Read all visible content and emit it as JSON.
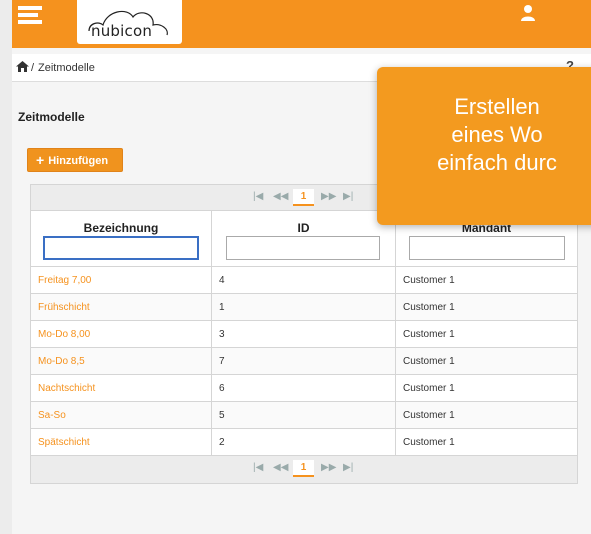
{
  "header": {
    "logo_text": "nubicon",
    "brand_color": "#f5921e"
  },
  "breadcrumb": {
    "home_icon": "home-icon",
    "separator": "/",
    "current": "Zeitmodelle"
  },
  "help_icon_glyph": "?",
  "page_title": "Zeitmodelle",
  "add_button_label": "Hinzufügen",
  "pager": {
    "first": "⏮",
    "prev": "⏪",
    "page": "1",
    "next": "⏩",
    "last": "⏭"
  },
  "table": {
    "columns": [
      "Bezeichnung",
      "ID",
      "Mandant"
    ],
    "filters": [
      "",
      "",
      ""
    ],
    "rows": [
      {
        "name": "Freitag 7,00",
        "id": "4",
        "tenant": "Customer 1"
      },
      {
        "name": "Frühschicht",
        "id": "1",
        "tenant": "Customer 1"
      },
      {
        "name": "Mo-Do 8,00",
        "id": "3",
        "tenant": "Customer 1"
      },
      {
        "name": "Mo-Do 8,5",
        "id": "7",
        "tenant": "Customer 1"
      },
      {
        "name": "Nachtschicht",
        "id": "6",
        "tenant": "Customer 1"
      },
      {
        "name": "Sa-So",
        "id": "5",
        "tenant": "Customer 1"
      },
      {
        "name": "Spätschicht",
        "id": "2",
        "tenant": "Customer 1"
      }
    ]
  },
  "tooltip": {
    "line1": "Erstellen",
    "line2": "eines Wo",
    "line3": "einfach durc"
  }
}
